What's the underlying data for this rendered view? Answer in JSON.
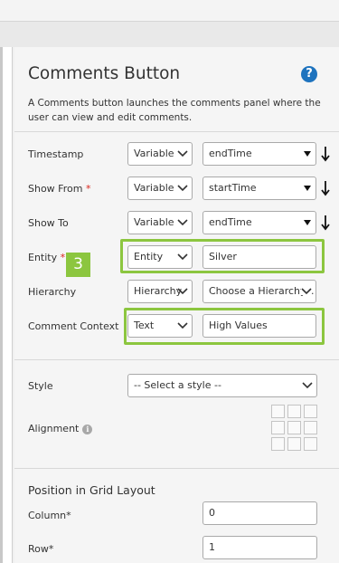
{
  "panel": {
    "title": "Comments Button",
    "description": "A Comments button launches the comments panel where the user can view and edit comments."
  },
  "rows": {
    "timestamp": {
      "label": "Timestamp",
      "type": "Variable",
      "value": "endTime"
    },
    "show_from": {
      "label": "Show From",
      "required": "*",
      "type": "Variable",
      "value": "startTime"
    },
    "show_to": {
      "label": "Show To",
      "type": "Variable",
      "value": "endTime"
    },
    "entity": {
      "label": "Entity",
      "required": "*",
      "type": "Entity",
      "value": "Silver"
    },
    "hierarchy": {
      "label": "Hierarchy",
      "type": "Hierarchy",
      "value": "Choose a Hierarchy..."
    },
    "comment_context": {
      "label": "Comment Context",
      "type": "Text",
      "value": "High Values"
    }
  },
  "callout": {
    "number": "3",
    "color": "#8cc63f"
  },
  "style": {
    "label": "Style",
    "value": "-- Select a style --"
  },
  "alignment": {
    "label": "Alignment",
    "info_icon": "i"
  },
  "position": {
    "heading": "Position in Grid Layout",
    "column_label": "Column*",
    "column_value": "0",
    "row_label": "Row*",
    "row_value": "1"
  },
  "help_icon": "?",
  "colors": {
    "help": "#1e73be",
    "highlight": "#8cc63f",
    "required": "#d9261c"
  }
}
